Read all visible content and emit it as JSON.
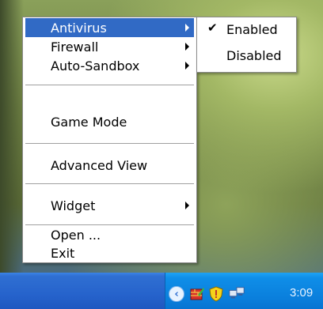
{
  "menu": {
    "items": [
      {
        "label": "Antivirus",
        "has_submenu": true,
        "highlighted": true
      },
      {
        "label": "Firewall",
        "has_submenu": true
      },
      {
        "label": "Auto-Sandbox",
        "has_submenu": true
      },
      {
        "label": "Game Mode",
        "has_submenu": false
      },
      {
        "label": "Advanced View",
        "has_submenu": false
      },
      {
        "label": "Widget",
        "has_submenu": true
      },
      {
        "label": "Open ...",
        "has_submenu": false
      },
      {
        "label": "Exit",
        "has_submenu": false
      }
    ]
  },
  "submenu": {
    "items": [
      {
        "label": "Enabled",
        "checked": true,
        "check_glyph": "✔"
      },
      {
        "label": "Disabled",
        "checked": false
      }
    ]
  },
  "taskbar": {
    "clock": "3:09",
    "tray_icons": [
      "show-hidden-icons-chevron",
      "firewall-icon",
      "security-shield-icon",
      "network-connection-icon"
    ]
  },
  "colors": {
    "highlight": "#316ac5",
    "taskbar": "#2663cc",
    "tray": "#0a7fdc"
  }
}
